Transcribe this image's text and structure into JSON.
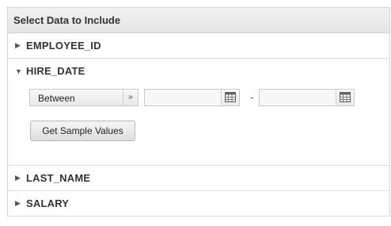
{
  "panel": {
    "title": "Select Data to Include",
    "fields": [
      {
        "label": "EMPLOYEE_ID",
        "expanded": false
      },
      {
        "label": "HIRE_DATE",
        "expanded": true
      },
      {
        "label": "LAST_NAME",
        "expanded": false
      },
      {
        "label": "SALARY",
        "expanded": false
      }
    ]
  },
  "filter": {
    "operator": "Between",
    "from_value": "",
    "to_value": "",
    "range_separator": "-",
    "sample_button_label": "Get Sample Values"
  },
  "icons": {
    "collapsed": "triangle-right-icon",
    "expanded": "triangle-down-icon",
    "select_arrow": "double-chevron-down-icon",
    "calendar": "calendar-icon"
  }
}
